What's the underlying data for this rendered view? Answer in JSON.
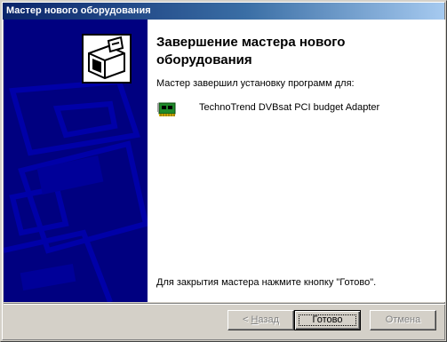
{
  "window": {
    "title": "Мастер нового оборудования"
  },
  "page": {
    "heading": "Завершение мастера нового оборудования",
    "subtitle": "Мастер завершил установку программ для:",
    "device": {
      "icon": "network-card-icon",
      "name": "TechnoTrend DVBsat PCI budget Adapter"
    },
    "footer_note": "Для закрытия мастера нажмите кнопку \"Готово\"."
  },
  "buttons": {
    "back_prefix": "< ",
    "back_underlined": "Н",
    "back_rest": "азад",
    "finish": "Готово",
    "cancel": "Отмена"
  },
  "colors": {
    "titlebar_start": "#0a246a",
    "titlebar_end": "#a6caf0",
    "side_panel": "#000080",
    "dialog_face": "#d4d0c8"
  }
}
